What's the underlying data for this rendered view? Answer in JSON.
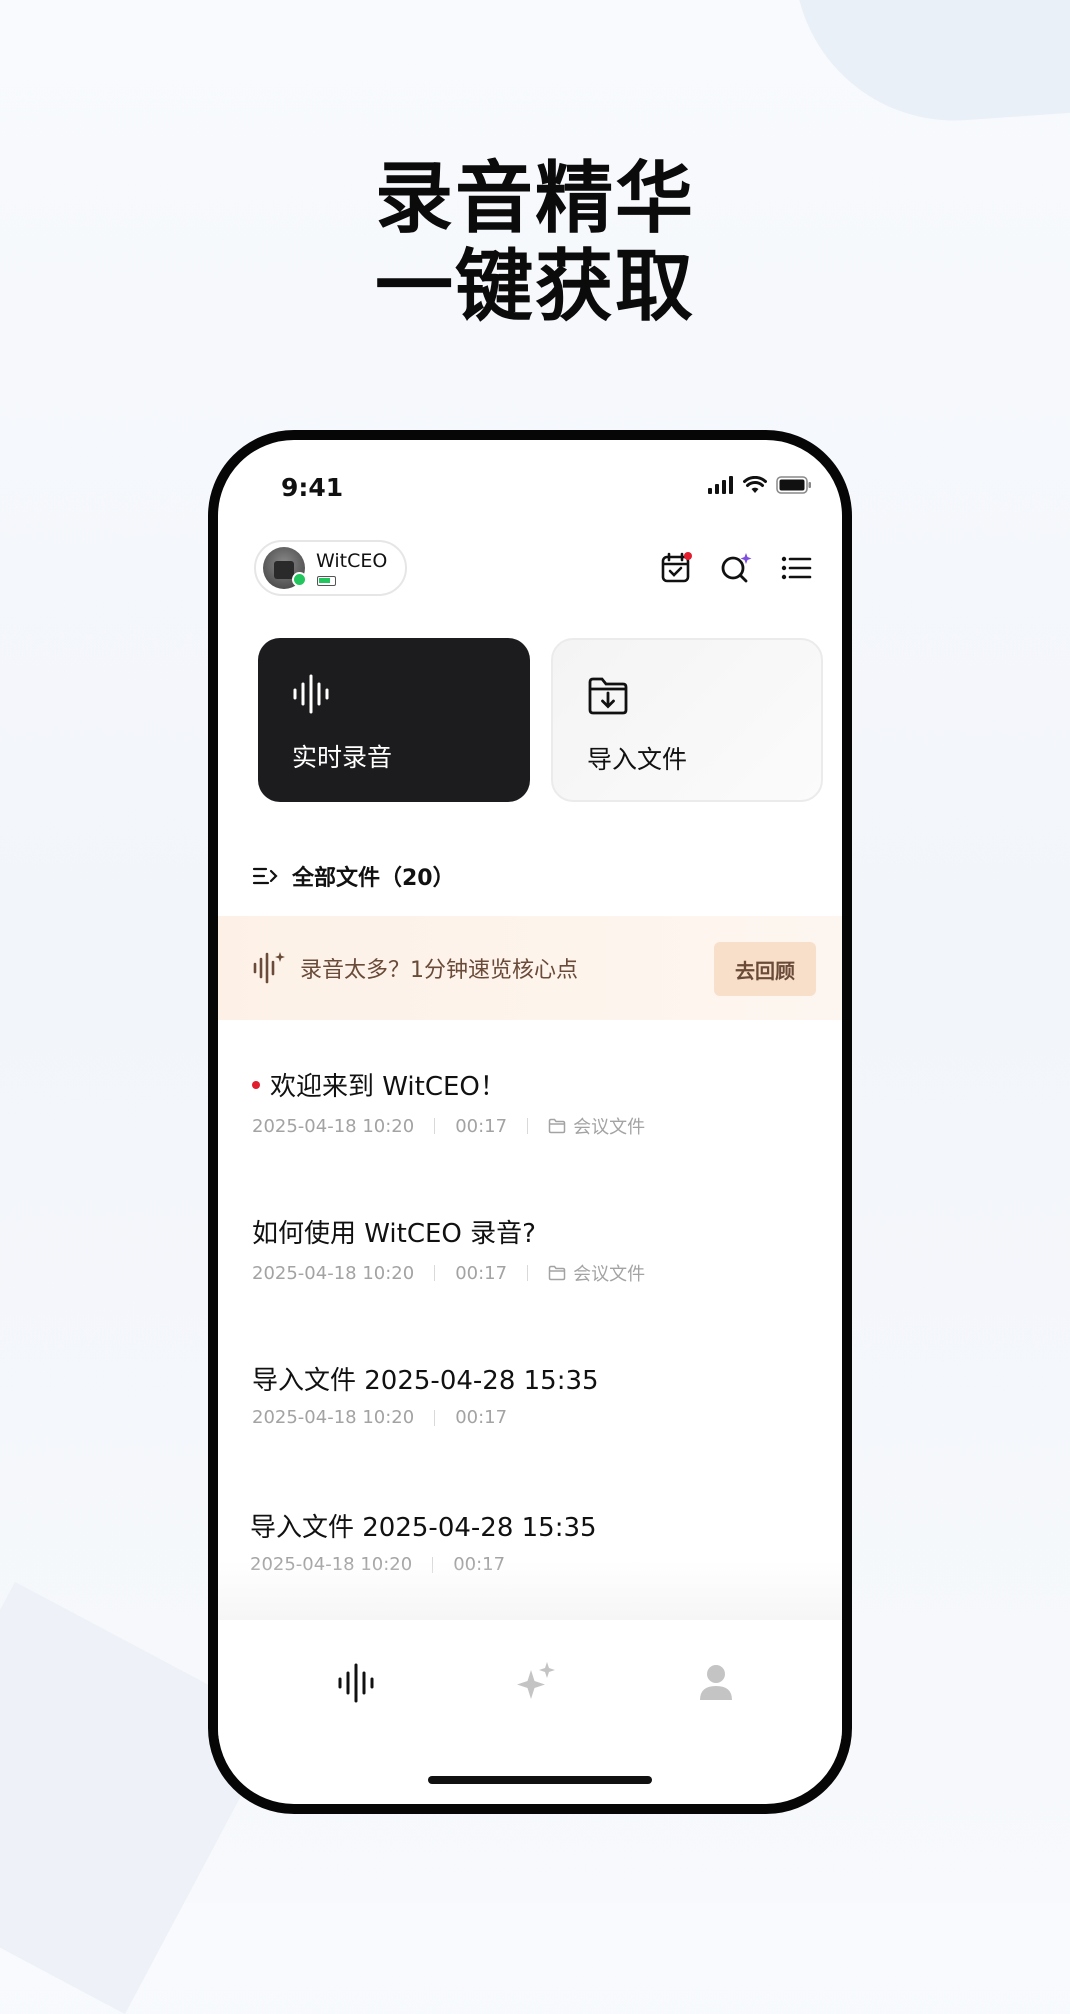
{
  "headline": {
    "line1": "录音精华",
    "line2": "一键获取"
  },
  "status_bar": {
    "time": "9:41"
  },
  "device": {
    "name": "WitCEO",
    "status_color": "#22c55e"
  },
  "actions": {
    "record_label": "实时录音",
    "import_label": "导入文件"
  },
  "files_header": {
    "label": "全部文件（20）"
  },
  "banner": {
    "text": "录音太多？1分钟速览核心点",
    "button": "去回顾"
  },
  "files": [
    {
      "title": "欢迎来到 WitCEO！",
      "unread": true,
      "date": "2025-04-18 10:20",
      "duration": "00:17",
      "folder": "会议文件"
    },
    {
      "title": "如何使用 WitCEO 录音?",
      "unread": false,
      "date": "2025-04-18 10:20",
      "duration": "00:17",
      "folder": "会议文件"
    },
    {
      "title": "导入文件 2025-04-28 15:35",
      "unread": false,
      "date": "2025-04-18 10:20",
      "duration": "00:17",
      "folder": ""
    },
    {
      "title": "导入文件 2025-04-28 15:35",
      "unread": false,
      "date": "2025-04-18 10:20",
      "duration": "00:17",
      "folder": ""
    }
  ],
  "tabs": [
    "waveform-icon",
    "sparkle-icon",
    "person-icon"
  ],
  "colors": {
    "accent_dark": "#1c1c1e",
    "banner_text": "#6a4a38",
    "banner_button_bg": "#f8dfca",
    "unread_dot": "#e11d2e"
  }
}
